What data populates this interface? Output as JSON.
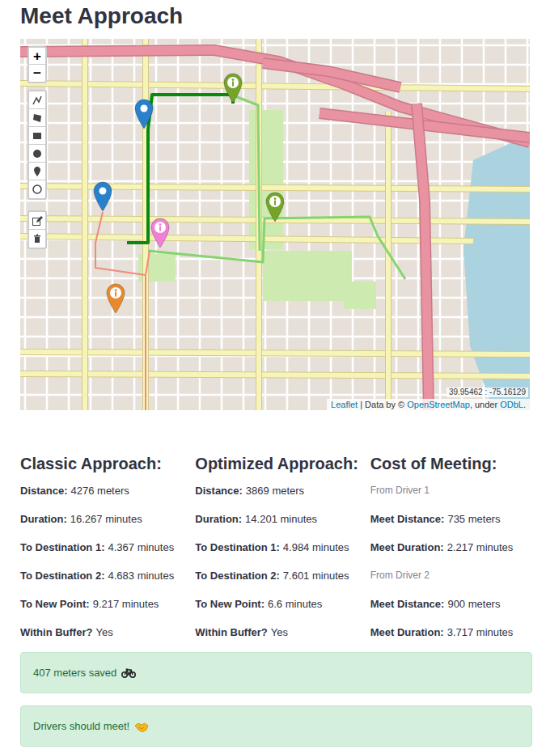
{
  "page": {
    "title": "Meet Approach"
  },
  "map": {
    "zoom": {
      "in": "+",
      "out": "−"
    },
    "draw_tools": [
      {
        "kind": "polyline"
      },
      {
        "kind": "polygon"
      },
      {
        "kind": "rectangle"
      },
      {
        "kind": "circle"
      },
      {
        "kind": "marker"
      },
      {
        "kind": "circlemarker"
      }
    ],
    "edit_tools": [
      {
        "kind": "edit"
      },
      {
        "kind": "delete"
      }
    ],
    "routes": [
      {
        "color": "#0a8a0a"
      },
      {
        "color": "#86d46f"
      },
      {
        "color": "#f08a7e"
      }
    ],
    "markers": [
      {
        "kind": "plain",
        "color": "#2a81cb"
      },
      {
        "kind": "plain",
        "color": "#2a81cb"
      },
      {
        "kind": "info",
        "color": "#f27fd6"
      },
      {
        "kind": "info",
        "color": "#e8892b"
      },
      {
        "kind": "info",
        "color": "#76a32a"
      },
      {
        "kind": "info",
        "color": "#76a32a"
      }
    ],
    "coordinates": "39.95462 : -75.16129",
    "attribution": [
      {
        "text": "Leaflet",
        "link": true
      },
      {
        "text": " | Data by © ",
        "link": false
      },
      {
        "text": "OpenStreetMap",
        "link": true
      },
      {
        "text": ", under ",
        "link": false
      },
      {
        "text": "ODbL",
        "link": true
      },
      {
        "text": ".",
        "link": false
      }
    ]
  },
  "approaches": [
    {
      "title": "Classic Approach:",
      "rows": [
        {
          "label": "Distance:",
          "value": "4276 meters"
        },
        {
          "label": "Duration:",
          "value": "16.267 minutes"
        },
        {
          "label": "To Destination 1:",
          "value": "4.367 minutes"
        },
        {
          "label": "To Destination 2:",
          "value": "4.683 minutes"
        },
        {
          "label": "To New Point:",
          "value": "9.217 minutes"
        },
        {
          "label": "Within Buffer?",
          "value": "Yes"
        }
      ]
    },
    {
      "title": "Optimized Approach:",
      "rows": [
        {
          "label": "Distance:",
          "value": "3869 meters"
        },
        {
          "label": "Duration:",
          "value": "14.201 minutes"
        },
        {
          "label": "To Destination 1:",
          "value": "4.984 minutes"
        },
        {
          "label": "To Destination 2:",
          "value": "7.601 minutes"
        },
        {
          "label": "To New Point:",
          "value": "6.6 minutes"
        },
        {
          "label": "Within Buffer?",
          "value": "Yes"
        }
      ]
    }
  ],
  "cost": {
    "title": "Cost of Meeting:",
    "groups": [
      {
        "caption": "From Driver 1",
        "rows": [
          {
            "label": "Meet Distance:",
            "value": "735 meters"
          },
          {
            "label": "Meet Duration:",
            "value": "2.217 minutes"
          }
        ]
      },
      {
        "caption": "From Driver 2",
        "rows": [
          {
            "label": "Meet Distance:",
            "value": "900 meters"
          },
          {
            "label": "Meet Duration:",
            "value": "3.717 minutes"
          }
        ]
      }
    ]
  },
  "alerts": [
    {
      "text": "407 meters saved",
      "kind": "bicycle"
    },
    {
      "text": "Drivers should meet!",
      "kind": "handshake"
    }
  ]
}
